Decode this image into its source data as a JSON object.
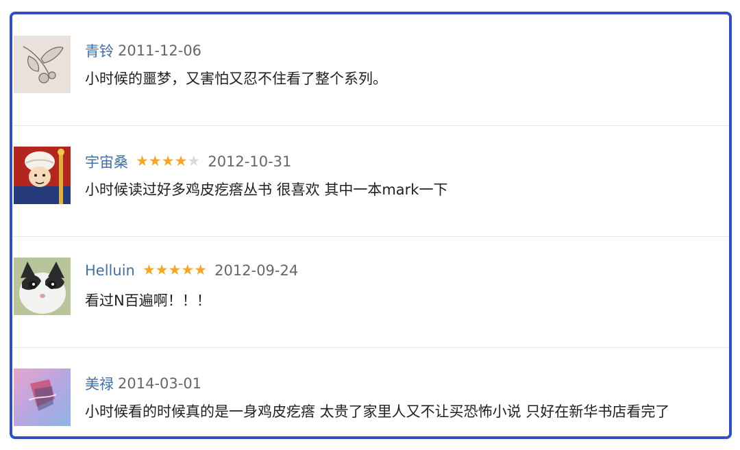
{
  "comments": [
    {
      "author": "青铃",
      "date": "2011-12-06",
      "rating": null,
      "text": "小时候的噩梦，又害怕又忍不住看了整个系列。",
      "avatar": "leaf-sketch-avatar"
    },
    {
      "author": "宇宙桑",
      "date": "2012-10-31",
      "rating": 4,
      "text": "小时候读过好多鸡皮疙瘩丛书 很喜欢 其中一本mark一下",
      "avatar": "cartoon-character-avatar"
    },
    {
      "author": "Helluin",
      "date": "2012-09-24",
      "rating": 5,
      "text": "看过N百遍啊！！！",
      "avatar": "cat-avatar"
    },
    {
      "author": "美禄",
      "date": "2014-03-01",
      "rating": null,
      "text": "小时候看的时候真的是一身鸡皮疙瘩 太贵了家里人又不让买恐怖小说 只好在新华书店看完了",
      "avatar": "abstract-pink-avatar"
    }
  ],
  "colors": {
    "frame": "#2f4fc9",
    "author": "#3f6fa8",
    "star": "#f5a623"
  }
}
